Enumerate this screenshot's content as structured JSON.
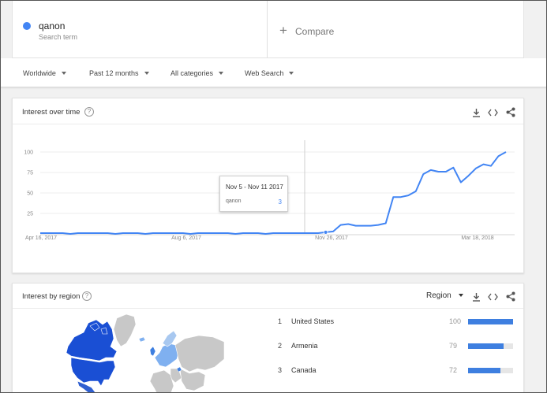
{
  "search_term": {
    "name": "qanon",
    "subtitle": "Search term",
    "color": "#4285f4"
  },
  "compare": {
    "label": "Compare",
    "plus": "+"
  },
  "filters": [
    {
      "label": "Worldwide"
    },
    {
      "label": "Past 12 months"
    },
    {
      "label": "All categories"
    },
    {
      "label": "Web Search"
    }
  ],
  "interest_over_time": {
    "title": "Interest over time",
    "help": "?",
    "tooltip": {
      "date": "Nov 5 - Nov 11 2017",
      "term": "qanon",
      "value": "3"
    }
  },
  "interest_by_region": {
    "title": "Interest by region",
    "help": "?",
    "resolution": "Region",
    "rows": [
      {
        "rank": "1",
        "name": "United States",
        "value": "100",
        "score": 100
      },
      {
        "rank": "2",
        "name": "Armenia",
        "value": "79",
        "score": 79
      },
      {
        "rank": "3",
        "name": "Canada",
        "value": "72",
        "score": 72
      }
    ]
  },
  "icons": [
    "download-icon",
    "embed-icon",
    "share-icon",
    "help-icon",
    "chevron-down-icon"
  ],
  "colors": {
    "line": "#4285f4",
    "bar": "#3e7fe0",
    "map_high": "#1a4fd4",
    "map_mid": "#7fb0f0",
    "map_none": "#c8c8c8"
  },
  "chart_data": {
    "type": "line",
    "title": "Interest over time",
    "xlabel": "",
    "ylabel": "",
    "ylim": [
      0,
      100
    ],
    "yticks": [
      "100",
      "75",
      "50",
      "25"
    ],
    "xtick_labels": [
      "Apr 16, 2017",
      "Aug 6, 2017",
      "Nov 26, 2017",
      "Mar 18, 2018"
    ],
    "grid": true,
    "series": [
      {
        "name": "qanon",
        "values": [
          1,
          1,
          1,
          1,
          0,
          1,
          1,
          1,
          1,
          1,
          0,
          1,
          1,
          1,
          0,
          1,
          1,
          1,
          1,
          1,
          0,
          1,
          1,
          1,
          1,
          1,
          0,
          1,
          1,
          1,
          0,
          1,
          1,
          1,
          1,
          1,
          1,
          1,
          2,
          3,
          11,
          12,
          10,
          10,
          10,
          11,
          13,
          45,
          45,
          47,
          52,
          73,
          78,
          76,
          76,
          81,
          63,
          71,
          80,
          85,
          83,
          95,
          100
        ]
      }
    ],
    "highlight_index": 38
  }
}
